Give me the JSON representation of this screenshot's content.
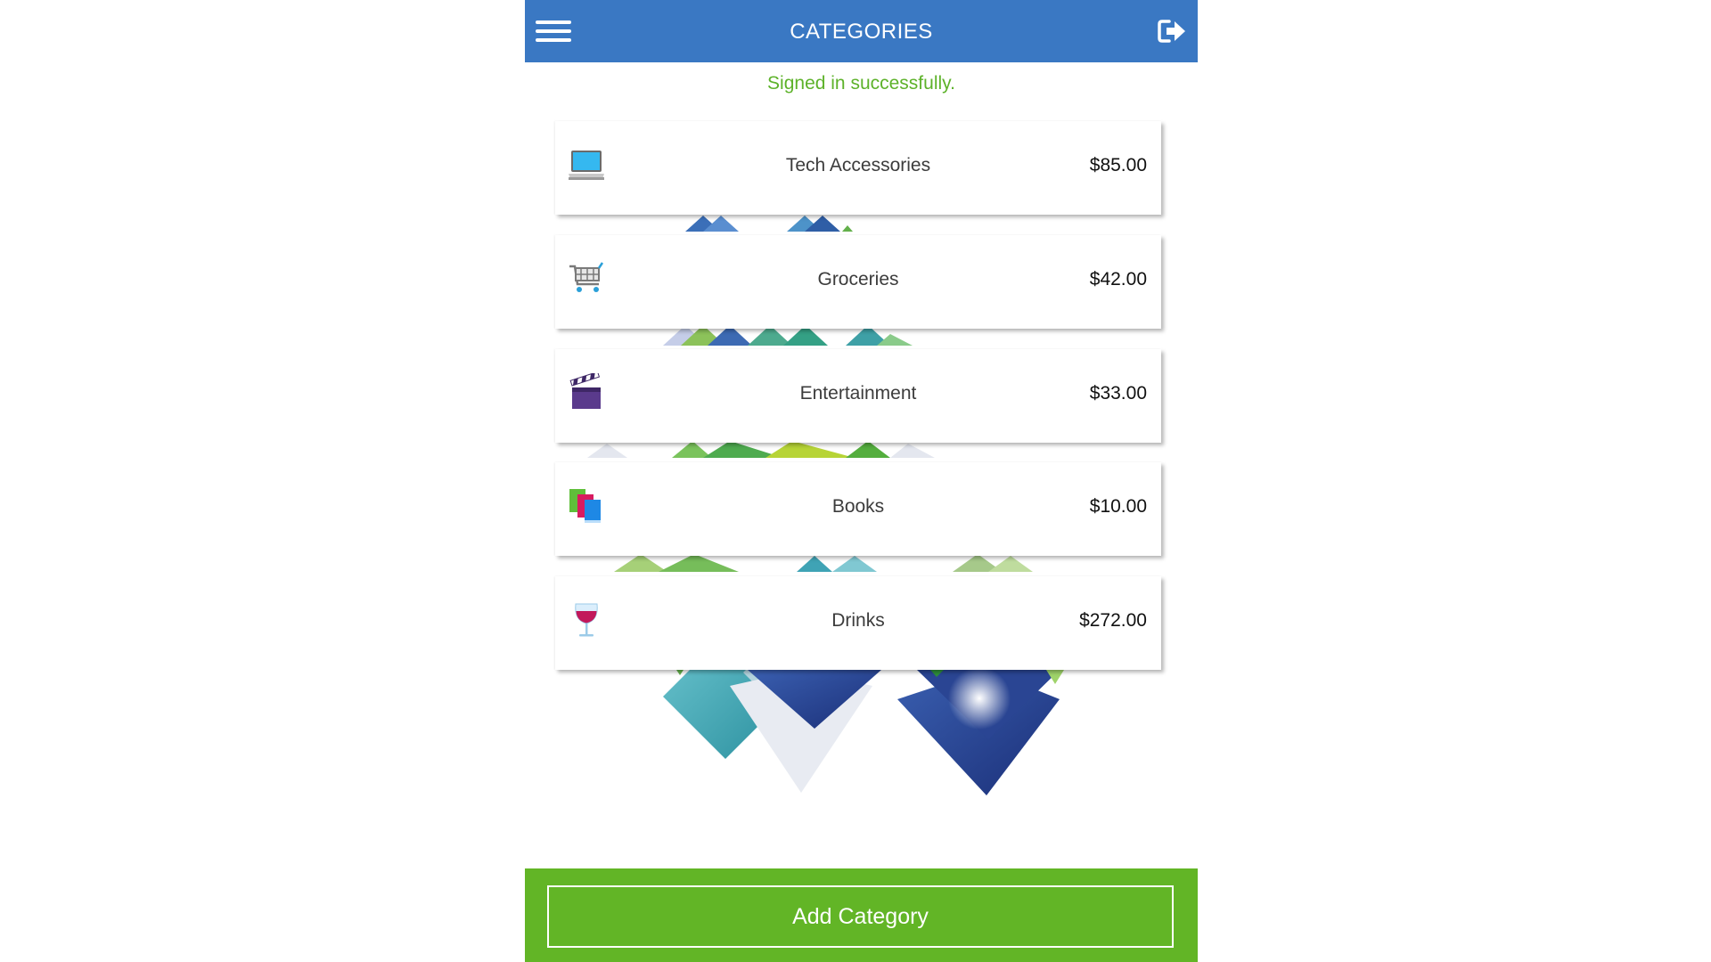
{
  "header": {
    "title": "CATEGORIES",
    "menu_icon": "hamburger-menu-icon",
    "signout_icon": "sign-out-icon"
  },
  "status_message": "Signed in successfully.",
  "categories": [
    {
      "name": "Tech Accessories",
      "amount": "$85.00",
      "icon": "laptop-icon"
    },
    {
      "name": "Groceries",
      "amount": "$42.00",
      "icon": "shopping-cart-icon"
    },
    {
      "name": "Entertainment",
      "amount": "$33.00",
      "icon": "clapperboard-icon"
    },
    {
      "name": "Books",
      "amount": "$10.00",
      "icon": "books-icon"
    },
    {
      "name": "Drinks",
      "amount": "$272.00",
      "icon": "wine-glass-icon"
    }
  ],
  "footer": {
    "add_label": "Add Category"
  },
  "colors": {
    "header": "#3a78c3",
    "status": "#5db22a",
    "footer": "#62b526"
  }
}
